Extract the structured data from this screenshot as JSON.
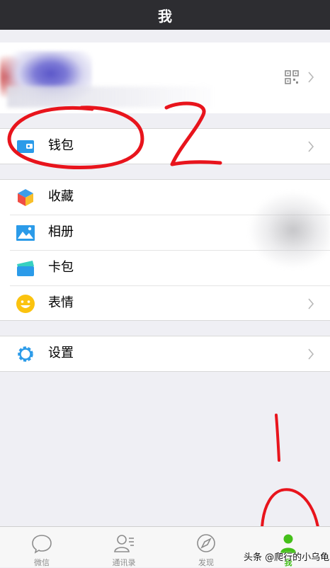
{
  "header": {
    "title": "我"
  },
  "profile": {
    "qr_icon": "qr-code-icon"
  },
  "menu": {
    "wallet": {
      "label": "钱包",
      "icon": "wallet-icon"
    },
    "favorites": {
      "label": "收藏",
      "icon": "cube-icon"
    },
    "album": {
      "label": "相册",
      "icon": "image-icon"
    },
    "cards": {
      "label": "卡包",
      "icon": "card-icon"
    },
    "stickers": {
      "label": "表情",
      "icon": "smiley-icon"
    },
    "settings": {
      "label": "设置",
      "icon": "gear-icon"
    }
  },
  "tabbar": {
    "items": [
      {
        "label": "微信",
        "icon": "chat-bubble-icon",
        "active": false
      },
      {
        "label": "通讯录",
        "icon": "contacts-icon",
        "active": false
      },
      {
        "label": "发现",
        "icon": "compass-icon",
        "active": false
      },
      {
        "label": "我",
        "icon": "person-icon",
        "active": true
      }
    ]
  },
  "annotations": {
    "big_number": "2",
    "small_number": "1"
  },
  "watermark": {
    "text": "头条 @爬行的小乌龟"
  },
  "colors": {
    "accent_green": "#45c01a",
    "annotation_red": "#e8141c",
    "header_bg": "#2d2d31"
  }
}
